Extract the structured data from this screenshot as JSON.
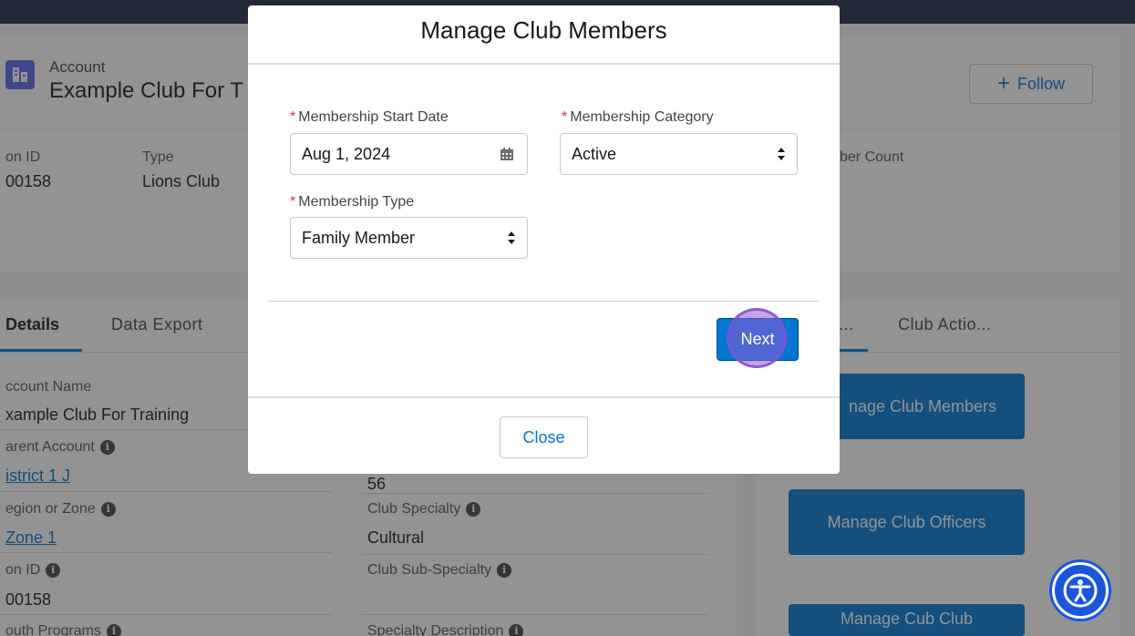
{
  "header": {
    "object_type": "Account",
    "account_name": "Example Club For T",
    "follow_label": "Follow"
  },
  "highlights": {
    "id_label": "on ID",
    "id_value": "00158",
    "type_label": "Type",
    "type_value": "Lions Club",
    "count_label": "ber Count"
  },
  "tabs": {
    "details": "Details",
    "data_export": "Data Export",
    "right_tab_1": "...",
    "right_tab_2": "Club Actio..."
  },
  "fields": {
    "account_name_label": "ccount Name",
    "account_name_value": "xample Club For Training",
    "parent_label": "arent Account",
    "parent_value": "istrict 1 J",
    "region_label": "egion or Zone",
    "region_value": "Zone 1",
    "lion_id_label": "on ID",
    "lion_id_value": "00158",
    "youth_label": "outh Programs",
    "number_value": "56",
    "specialty_label": "Club Specialty",
    "specialty_value": "Cultural",
    "sub_specialty_label": "Club Sub-Specialty",
    "specialty_desc_label": "Specialty Description"
  },
  "actions": {
    "manage_members": "nage Club Members",
    "manage_officers": "Manage Club Officers",
    "manage_cub": "Manage Cub Club"
  },
  "modal": {
    "title": "Manage Club Members",
    "start_date_label": "Membership Start Date",
    "start_date_value": "Aug 1, 2024",
    "category_label": "Membership Category",
    "category_value": "Active",
    "type_label": "Membership Type",
    "type_value": "Family Member",
    "required_marker": "*",
    "next_label": "Next",
    "close_label": "Close"
  },
  "icons": {
    "account": "account-grid-icon",
    "calendar": "calendar-icon",
    "stepper": "select-stepper-icon",
    "info": "info-icon",
    "accessibility": "accessibility-icon"
  },
  "colors": {
    "brand_blue": "#0176d3",
    "required_red": "#c23934",
    "topbar": "#1b2a4a",
    "click_highlight": "#9159d2"
  }
}
